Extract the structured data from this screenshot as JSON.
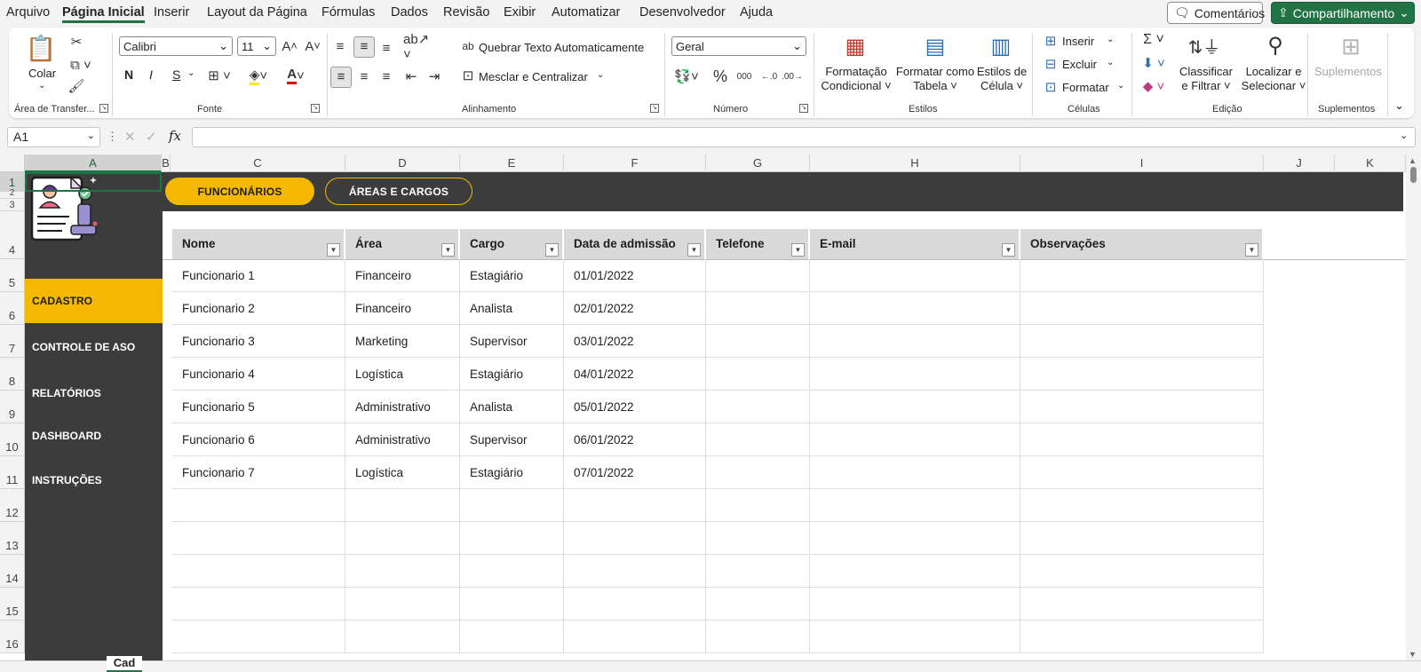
{
  "menu": {
    "items": [
      "Arquivo",
      "Página Inicial",
      "Inserir",
      "Layout da Página",
      "Fórmulas",
      "Dados",
      "Revisão",
      "Exibir",
      "Automatizar",
      "Desenvolvedor",
      "Ajuda"
    ],
    "comments": "Comentários",
    "share": "Compartilhamento"
  },
  "ribbon": {
    "clipboard": {
      "paste": "Colar",
      "label": "Área de Transfer..."
    },
    "font": {
      "name": "Calibri",
      "size": "11",
      "bold": "N",
      "italic": "I",
      "underline": "S",
      "label": "Fonte"
    },
    "alignment": {
      "wrap": "Quebrar Texto Automaticamente",
      "merge": "Mesclar e Centralizar",
      "label": "Alinhamento"
    },
    "number": {
      "format": "Geral",
      "label": "Número"
    },
    "styles": {
      "conditional": "Formatação",
      "conditional2": "Condicional",
      "table": "Formatar como",
      "table2": "Tabela",
      "cell": "Estilos de",
      "cell2": "Célula",
      "label": "Estilos"
    },
    "cells": {
      "insert": "Inserir",
      "delete": "Excluir",
      "format": "Formatar",
      "label": "Células"
    },
    "editing": {
      "sort": "Classificar",
      "sort2": "e Filtrar",
      "find": "Localizar e",
      "find2": "Selecionar",
      "label": "Edição"
    },
    "addins": {
      "button": "Suplementos",
      "label": "Suplementos"
    }
  },
  "formula": {
    "namebox": "A1",
    "content": ""
  },
  "columns": [
    "A",
    "B",
    "C",
    "D",
    "E",
    "F",
    "G",
    "H",
    "I",
    "J",
    "K"
  ],
  "rows": [
    "1",
    "2",
    "3",
    "4",
    "5",
    "6",
    "7",
    "8",
    "9",
    "10",
    "11",
    "12",
    "13",
    "14",
    "15",
    "16"
  ],
  "nav": {
    "tab_func": "FUNCIONÁRIOS",
    "tab_areas": "ÁREAS E CARGOS",
    "items": [
      "CADASTRO",
      "CONTROLE DE ASO",
      "RELATÓRIOS",
      "DASHBOARD",
      "INSTRUÇÕES"
    ]
  },
  "table": {
    "headers": [
      "Nome",
      "Área",
      "Cargo",
      "Data de admissão",
      "Telefone",
      "E-mail",
      "Observações"
    ],
    "rows": [
      [
        "Funcionario 1",
        "Financeiro",
        "Estagiário",
        "01/01/2022",
        "",
        "",
        ""
      ],
      [
        "Funcionario 2",
        "Financeiro",
        "Analista",
        "02/01/2022",
        "",
        "",
        ""
      ],
      [
        "Funcionario 3",
        "Marketing",
        "Supervisor",
        "03/01/2022",
        "",
        "",
        ""
      ],
      [
        "Funcionario 4",
        "Logística",
        "Estagiário",
        "04/01/2022",
        "",
        "",
        ""
      ],
      [
        "Funcionario 5",
        "Administrativo",
        "Analista",
        "05/01/2022",
        "",
        "",
        ""
      ],
      [
        "Funcionario 6",
        "Administrativo",
        "Supervisor",
        "06/01/2022",
        "",
        "",
        ""
      ],
      [
        "Funcionario 7",
        "Logística",
        "Estagiário",
        "07/01/2022",
        "",
        "",
        ""
      ]
    ]
  },
  "sheet_tab": "Cad",
  "colors": {
    "accent": "#f5b800",
    "sidebar": "#3c3c3c",
    "excel_green": "#217346"
  }
}
